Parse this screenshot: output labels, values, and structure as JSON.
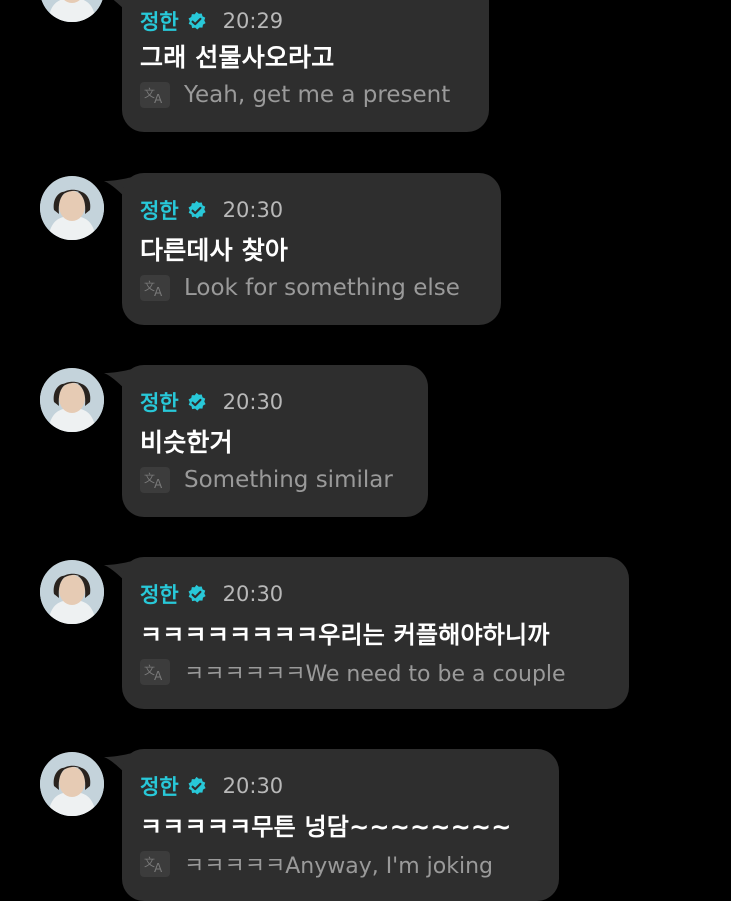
{
  "messages": [
    {
      "sender": "정한",
      "verified_icon": "verified-badge-icon",
      "time": "20:29",
      "text": "그래 선물사오라고",
      "translate_icon": "translate-icon",
      "translation": "Yeah, get me a present"
    },
    {
      "sender": "정한",
      "verified_icon": "verified-badge-icon",
      "time": "20:30",
      "text": "다른데사 찾아",
      "translate_icon": "translate-icon",
      "translation": "Look for something else"
    },
    {
      "sender": "정한",
      "verified_icon": "verified-badge-icon",
      "time": "20:30",
      "text": "비슷한거",
      "translate_icon": "translate-icon",
      "translation": "Something similar"
    },
    {
      "sender": "정한",
      "verified_icon": "verified-badge-icon",
      "time": "20:30",
      "text": "ㅋㅋㅋㅋㅋㅋㅋㅋ우리는 커플해야하니까",
      "translate_icon": "translate-icon",
      "translation": "ㅋㅋㅋㅋㅋㅋWe need to be a couple"
    },
    {
      "sender": "정한",
      "verified_icon": "verified-badge-icon",
      "time": "20:30",
      "text": "ㅋㅋㅋㅋㅋ무튼 넝담~~~~~~~~",
      "translate_icon": "translate-icon",
      "translation": "ㅋㅋㅋㅋㅋAnyway, I'm joking"
    }
  ],
  "colors": {
    "background": "#000000",
    "bubble": "#2e2e2e",
    "sender_name": "#28c8d8",
    "message_text": "#ffffff",
    "translation_text": "#9a9a9a",
    "timestamp": "#b8b8b8"
  }
}
